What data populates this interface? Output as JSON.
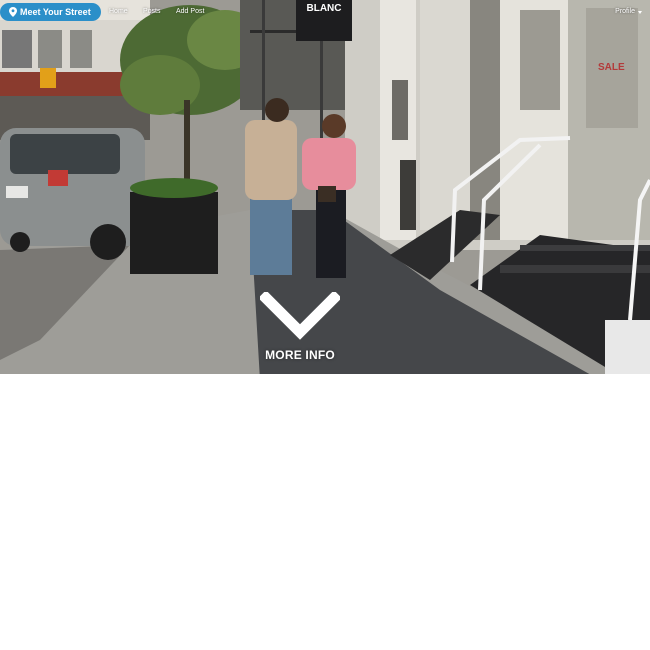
{
  "navbar": {
    "brand_label": "Meet Your Street",
    "links": [
      {
        "label": "Home"
      },
      {
        "label": "Posts"
      },
      {
        "label": "Add Post"
      }
    ],
    "profile_label": "Profile",
    "brand_color": "#2b8fc9"
  },
  "hero": {
    "more_info_label": "MORE INFO",
    "store_sign_label": "BLANC",
    "sale_sign_label": "SALE"
  }
}
